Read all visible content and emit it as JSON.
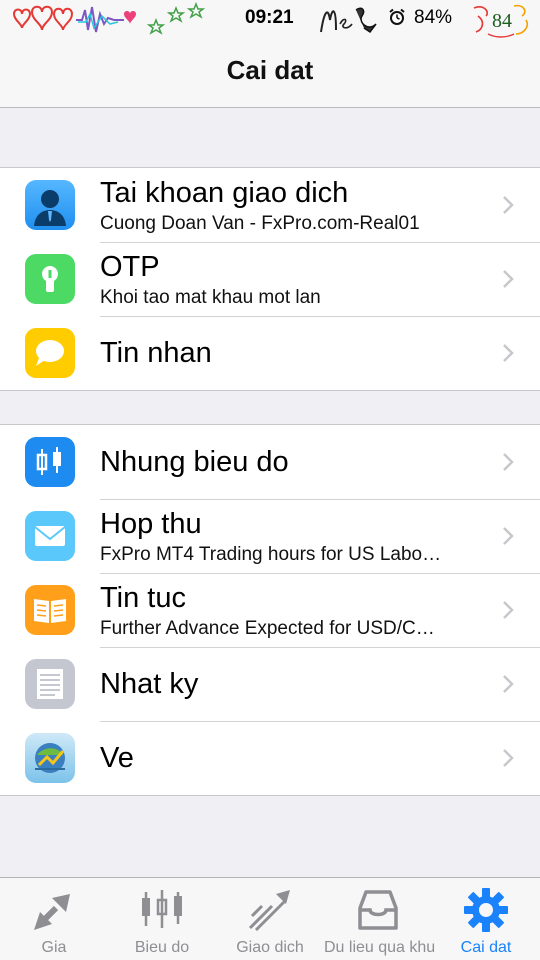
{
  "status_bar": {
    "time": "09:21",
    "battery": "84%",
    "badge": "84"
  },
  "nav": {
    "title": "Cai dat"
  },
  "groups": [
    {
      "rows": [
        {
          "title": "Tai khoan giao dich",
          "subtitle": "Cuong Doan Van - FxPro.com-Real01",
          "icon": "account-icon",
          "color": "#2b9cf5"
        },
        {
          "title": "OTP",
          "subtitle": "Khoi tao mat khau mot lan",
          "icon": "keyhole-icon",
          "color": "#4cd964"
        },
        {
          "title": "Tin nhan",
          "subtitle": "",
          "icon": "message-bubble-icon",
          "color": "#ffcc00"
        }
      ]
    },
    {
      "rows": [
        {
          "title": "Nhung bieu do",
          "subtitle": "",
          "icon": "candlestick-chart-icon",
          "color": "#1e8bf0"
        },
        {
          "title": "Hop thu",
          "subtitle": "FxPro MT4 Trading hours for US Labo…",
          "icon": "envelope-icon",
          "color": "#5ac8fa"
        },
        {
          "title": "Tin tuc",
          "subtitle": "Further Advance Expected for USD/C…",
          "icon": "open-book-icon",
          "color": "#ff9f1a"
        },
        {
          "title": "Nhat ky",
          "subtitle": "",
          "icon": "journal-lines-icon",
          "color": "#c4c7d0"
        },
        {
          "title": "Ve",
          "subtitle": "",
          "icon": "metatrader-logo-icon",
          "color": "#9fd3f0"
        }
      ]
    }
  ],
  "tabs": [
    {
      "label": "Gia",
      "icon": "quote-arrows-icon",
      "active": false
    },
    {
      "label": "Bieu do",
      "icon": "candlestick-icon",
      "active": false
    },
    {
      "label": "Giao dich",
      "icon": "trade-trend-icon",
      "active": false
    },
    {
      "label": "Du lieu qua khu",
      "icon": "history-tray-icon",
      "active": false
    },
    {
      "label": "Cai dat",
      "icon": "gear-icon",
      "active": true
    }
  ],
  "colors": {
    "accent": "#1a82fb",
    "inactive": "#8e8e93",
    "chevron": "#c7c7cc"
  }
}
